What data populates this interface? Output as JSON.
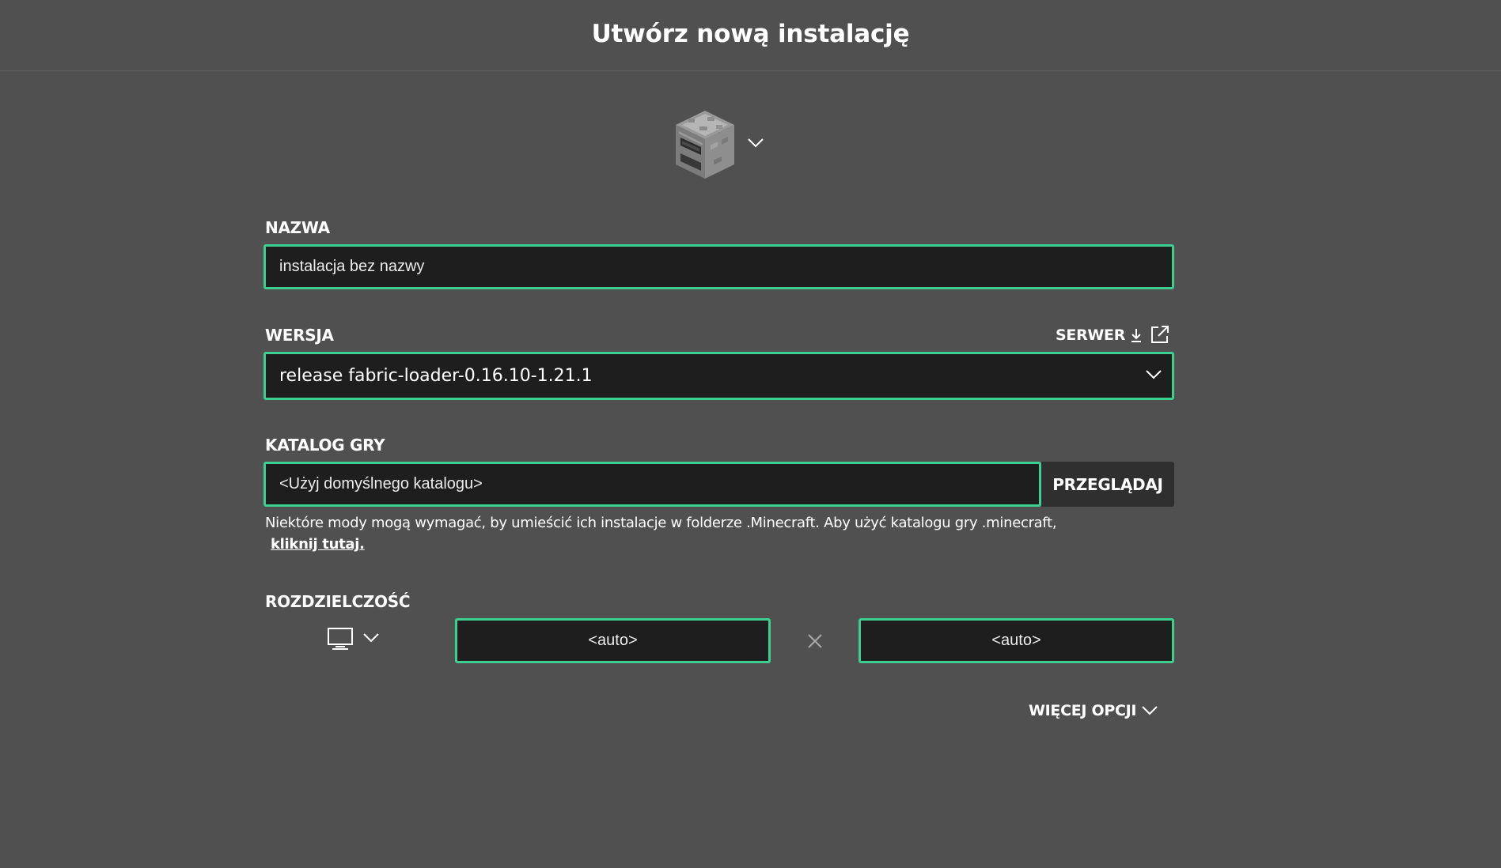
{
  "header": {
    "title": "Utwórz nową instalację"
  },
  "icon_picker": {
    "icon": "furnace-icon",
    "dropdown_icon": "chevron-down-icon"
  },
  "name_section": {
    "label": "NAZWA",
    "value": "instalacja bez nazwy"
  },
  "version_section": {
    "label": "WERSJA",
    "value": "release fabric-loader-0.16.10-1.21.1",
    "server_label": "SERWER",
    "server_icon": "download-icon",
    "external_icon": "external-link-icon"
  },
  "directory_section": {
    "label": "KATALOG GRY",
    "value": "<Użyj domyślnego katalogu>",
    "browse_label": "PRZEGLĄDAJ",
    "hint": "Niektóre mody mogą wymagać, by umieścić ich instalacje w folderze .Minecraft. Aby użyć katalogu gry .minecraft,",
    "hint_link": "kliknij tutaj."
  },
  "resolution_section": {
    "label": "ROZDZIELCZOŚĆ",
    "preset_icon": "monitor-icon",
    "width": "<auto>",
    "height": "<auto>",
    "separator_icon": "times-icon"
  },
  "more_options": {
    "label": "WIĘCEJ OPCJI"
  },
  "colors": {
    "background": "#505050",
    "field_bg": "#1e1e1e",
    "accent": "#3ccf91",
    "button_bg": "#2f2f2f"
  }
}
